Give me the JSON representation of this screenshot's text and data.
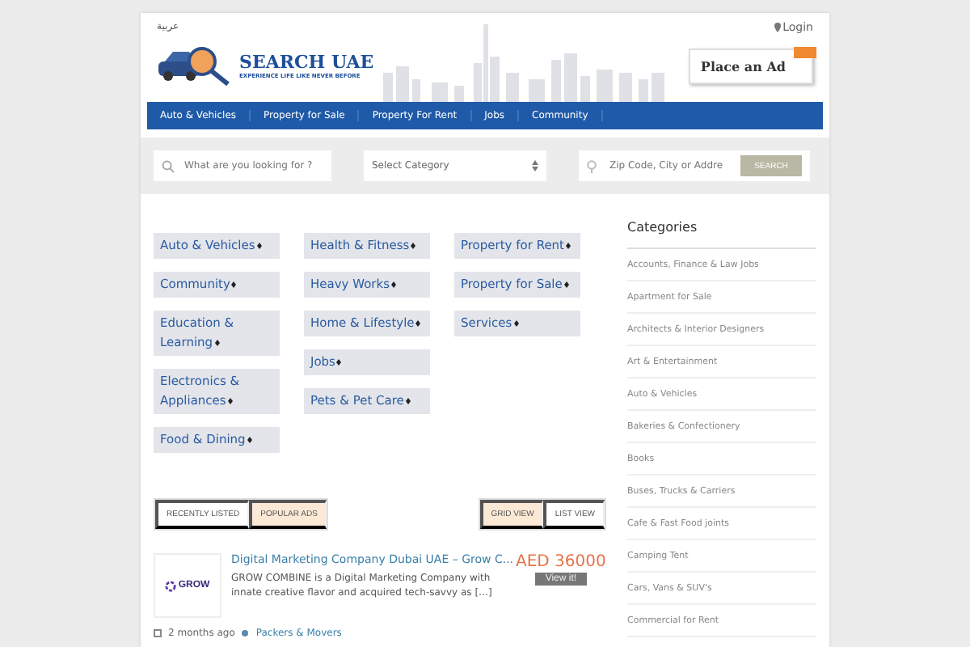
{
  "header": {
    "language_link": "عربية",
    "login_link": "Login",
    "logo": {
      "title": "SEARCH UAE",
      "tagline": "EXPERIENCE LIFE LIKE NEVER BEFORE"
    },
    "place_ad_button": "Place an Ad"
  },
  "nav": [
    "Auto & Vehicles",
    "Property for Sale",
    "Property For Rent",
    "Jobs",
    "Community"
  ],
  "search": {
    "keyword_placeholder": "What are you looking for ?",
    "category_select": "Select Category",
    "location_placeholder": "Zip Code, City or Addre",
    "search_button": "SEARCH"
  },
  "category_columns": [
    [
      "Auto & Vehicles",
      "Community",
      "Education & Learning",
      "Electronics & Appliances",
      "Food & Dining"
    ],
    [
      "Health & Fitness",
      "Heavy Works",
      "Home & Lifestyle",
      "Jobs",
      "Pets & Pet Care"
    ],
    [
      "Property for Rent",
      "Property for Sale",
      "Services"
    ]
  ],
  "listing_tabs": [
    {
      "label": "RECENTLY LISTED",
      "selected": false
    },
    {
      "label": "POPULAR ADS",
      "selected": true
    }
  ],
  "view_toggles": [
    {
      "label": "GRID VIEW",
      "selected": true
    },
    {
      "label": "LIST VIEW",
      "selected": false
    }
  ],
  "listing": {
    "logo_text": "GROW",
    "title": "Digital Marketing Company Dubai UAE – Grow C...",
    "description": "GROW COMBINE is a Digital Marketing Company with innate creative flavor and acquired tech-savvy as […]",
    "price": "AED 36000",
    "view_button": "View it!",
    "posted": "2 months ago",
    "category": "Packers & Movers"
  },
  "sidebar": {
    "title": "Categories",
    "items": [
      "Accounts, Finance & Law Jobs",
      "Apartment for Sale",
      "Architects & Interior Designers",
      "Art & Entertainment",
      "Auto & Vehicles",
      "Bakeries & Confectionery",
      "Books",
      "Buses, Trucks & Carriers",
      "Cafe & Fast Food joints",
      "Camping Tent",
      "Cars, Vans & SUV's",
      "Commercial for Rent"
    ]
  }
}
